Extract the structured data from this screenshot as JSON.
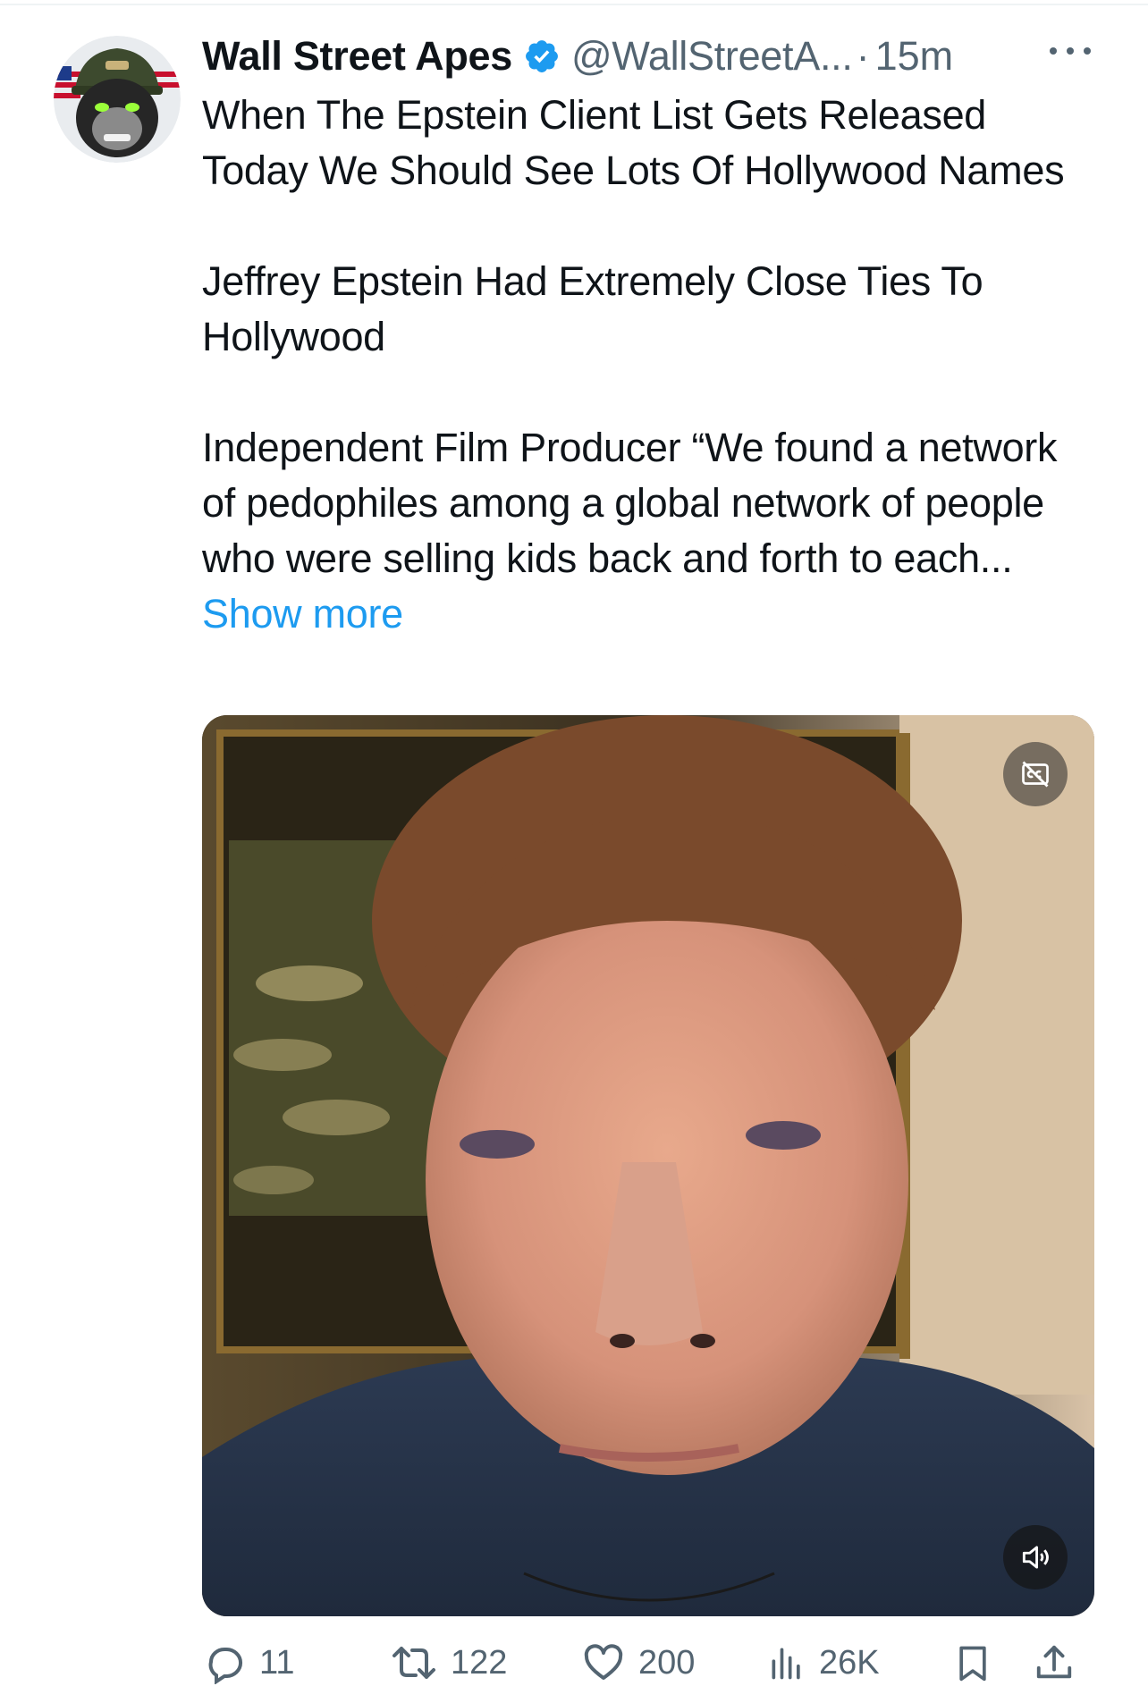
{
  "tweet": {
    "author": {
      "display_name": "Wall Street Apes",
      "handle": "@WallStreetA...",
      "verified": true,
      "avatar": "gorilla-helmet-avatar"
    },
    "separator": "·",
    "timestamp": "15m",
    "text": {
      "paragraph1": "When The Epstein Client List Gets Released Today We Should See Lots Of Hollywood Names",
      "paragraph2": "Jeffrey Epstein Had Extremely Close Ties To Hollywood",
      "paragraph3": "Independent Film Producer “We found a network of pedophiles among a global network of people who were selling kids back and forth to each...",
      "show_more": "Show more"
    },
    "media": {
      "type": "video",
      "captions_icon": "captions-off-icon",
      "volume_icon": "volume-muted-icon"
    },
    "metrics": {
      "replies": "11",
      "reposts": "122",
      "likes": "200",
      "views": "26K"
    }
  },
  "colors": {
    "text": "#0f1419",
    "secondary": "#536471",
    "link": "#1d9bf0",
    "verified": "#1d9bf0"
  }
}
